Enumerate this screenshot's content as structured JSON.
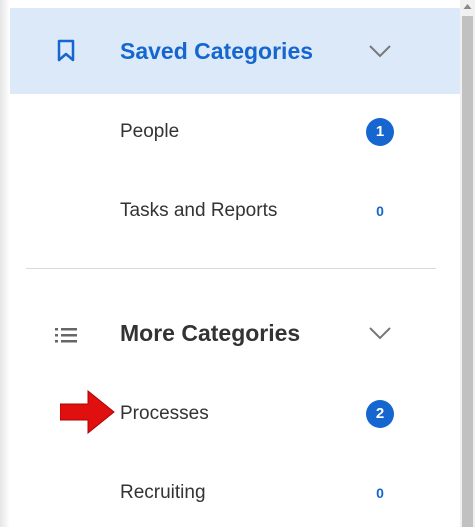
{
  "saved_section": {
    "title": "Saved Categories",
    "icon": "bookmark-icon",
    "items": [
      {
        "label": "People",
        "count": "1"
      },
      {
        "label": "Tasks and Reports",
        "count": "0"
      }
    ]
  },
  "more_section": {
    "title": "More Categories",
    "icon": "list-icon",
    "items": [
      {
        "label": "Processes",
        "count": "2"
      },
      {
        "label": "Recruiting",
        "count": "0"
      }
    ]
  },
  "colors": {
    "accent": "#1666cf",
    "header_highlight": "#dbe9f9",
    "annotation_arrow": "#e01010"
  }
}
